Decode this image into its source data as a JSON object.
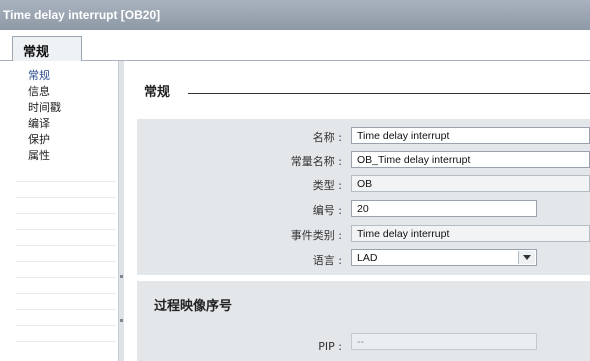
{
  "window": {
    "title": "Time delay interrupt [OB20]"
  },
  "tabs": [
    {
      "label": "常规"
    }
  ],
  "sidebar": {
    "items": [
      {
        "label": "常规"
      },
      {
        "label": "信息"
      },
      {
        "label": "时间戳"
      },
      {
        "label": "编译"
      },
      {
        "label": "保护"
      },
      {
        "label": "属性"
      }
    ]
  },
  "general": {
    "heading": "常规",
    "fields": {
      "name": {
        "label": "名称 :",
        "value": "Time delay interrupt"
      },
      "constant_name": {
        "label": "常量名称 :",
        "value": "OB_Time delay interrupt"
      },
      "type": {
        "label": "类型 :",
        "value": "OB"
      },
      "number": {
        "label": "编号 :",
        "value": "20"
      },
      "event_class": {
        "label": "事件类别 :",
        "value": "Time delay interrupt"
      },
      "language": {
        "label": "语言 :",
        "value": "LAD"
      }
    }
  },
  "process_image": {
    "heading": "过程映像序号",
    "pip": {
      "label": "PIP :",
      "value": "--"
    }
  }
}
